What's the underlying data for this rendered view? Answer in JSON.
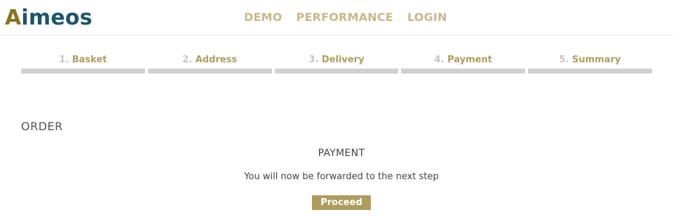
{
  "header": {
    "logo_first": "A",
    "logo_rest": "imeos",
    "nav": [
      "DEMO",
      "PERFORMANCE",
      "LOGIN"
    ]
  },
  "steps": [
    {
      "num": "1.",
      "label": "Basket"
    },
    {
      "num": "2.",
      "label": "Address"
    },
    {
      "num": "3.",
      "label": "Delivery"
    },
    {
      "num": "4.",
      "label": "Payment"
    },
    {
      "num": "5.",
      "label": "Summary"
    }
  ],
  "order": {
    "title": "ORDER",
    "payment_title": "PAYMENT",
    "forward_text": "You will now be forwarded to the next step",
    "proceed_label": "Proceed"
  },
  "colors": {
    "logo_first": "#8c7322",
    "logo_rest": "#1c5569",
    "nav": "#c7b98a",
    "step_label": "#ae9e5f",
    "step_bar": "#d0d0d0",
    "button": "#ad9c5e"
  }
}
